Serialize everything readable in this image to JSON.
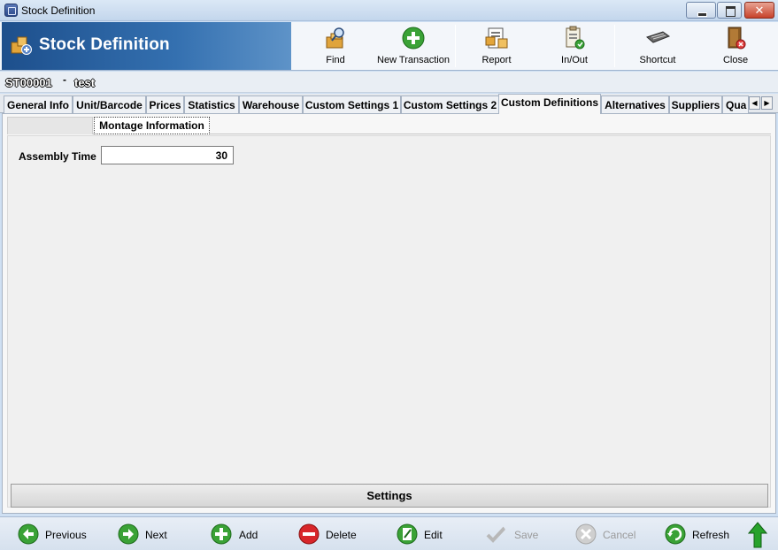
{
  "window": {
    "title": "Stock Definition"
  },
  "header": {
    "banner_title": "Stock Definition",
    "tools": {
      "find": "Find",
      "new_transaction": "New Transaction",
      "report": "Report",
      "in_out": "In/Out",
      "shortcut": "Shortcut",
      "close": "Close"
    }
  },
  "record": {
    "code": "ST00001",
    "separator": "-",
    "name": "test"
  },
  "tabs": {
    "general_info": "General Info",
    "unit_barcode": "Unit/Barcode",
    "prices": "Prices",
    "statistics": "Statistics",
    "warehouse": "Warehouse",
    "custom_settings_1": "Custom Settings 1",
    "custom_settings_2": "Custom Settings 2",
    "custom_definitions": "Custom Definitions",
    "alternatives": "Alternatives",
    "suppliers": "Suppliers",
    "quality": "Qua"
  },
  "subtab": {
    "montage_information": "Montage Information"
  },
  "form": {
    "assembly_time_label": "Assembly Time",
    "assembly_time_value": "30"
  },
  "settings_label": "Settings",
  "bottom": {
    "previous": "Previous",
    "next": "Next",
    "add": "Add",
    "delete": "Delete",
    "edit": "Edit",
    "save": "Save",
    "cancel": "Cancel",
    "refresh": "Refresh"
  },
  "colors": {
    "banner": "#2a62a3",
    "accent_green": "#3aa236",
    "delete_red": "#d8262a"
  }
}
